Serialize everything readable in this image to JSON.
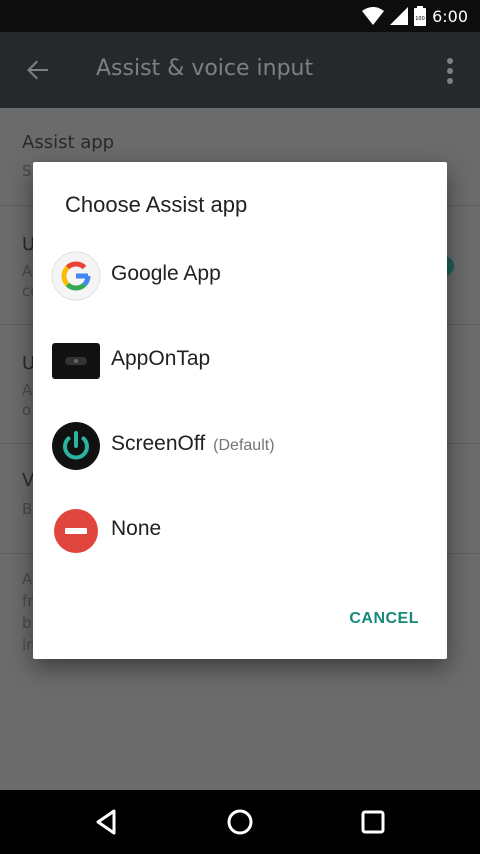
{
  "status_bar": {
    "time": "6:00",
    "battery_level": "100"
  },
  "app_bar": {
    "title": "Assist & voice input"
  },
  "background_prefs": [
    {
      "title": "Assist app",
      "subtitle": "S"
    },
    {
      "title": "U",
      "subtitle_lines": [
        "A",
        "co"
      ]
    },
    {
      "title": "U",
      "subtitle_lines": [
        "A",
        "o"
      ]
    },
    {
      "title": "V",
      "subtitle": "B"
    }
  ],
  "background_footer_lines": [
    "A",
    "fr",
    "b",
    "in"
  ],
  "dialog": {
    "title": "Choose Assist app",
    "options": [
      {
        "label": "Google App",
        "hint": "",
        "icon": "google-g-icon"
      },
      {
        "label": "AppOnTap",
        "hint": "",
        "icon": "apponTap-icon"
      },
      {
        "label": "ScreenOff",
        "hint": "(Default)",
        "icon": "power-icon"
      },
      {
        "label": "None",
        "hint": "",
        "icon": "minus-circle-icon"
      }
    ],
    "cancel_label": "CANCEL"
  },
  "colors": {
    "accent": "#17897a",
    "app_bar": "#25292b",
    "none_red": "#e0463d"
  }
}
